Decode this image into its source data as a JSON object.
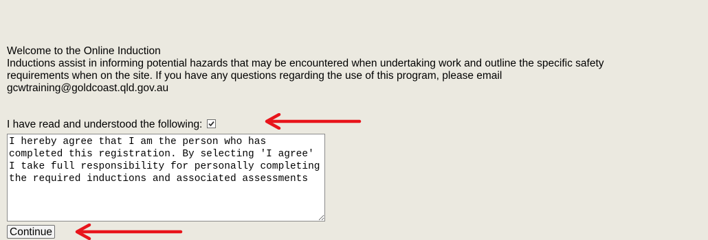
{
  "intro": {
    "welcome": "Welcome to the Online Induction",
    "line1": "Inductions assist in informing potential hazards that may be encountered when undertaking work and outline the specific safety",
    "line2": "requirements when on the site. If you have any questions regarding the use of this program, please email",
    "line3": "gcwtraining@goldcoast.qld.gov.au"
  },
  "agreement": {
    "checkbox_label": "I have read and understood the following:",
    "checked": true,
    "text": "I hereby agree that I am the person who has completed this registration. By selecting 'I agree' I take full responsibility for personally completing the required inductions and associated assessments"
  },
  "actions": {
    "continue_label": "Continue"
  },
  "annotations": {
    "arrow_color": "#e8141b",
    "arrow_icon": "left-arrow-icon"
  }
}
